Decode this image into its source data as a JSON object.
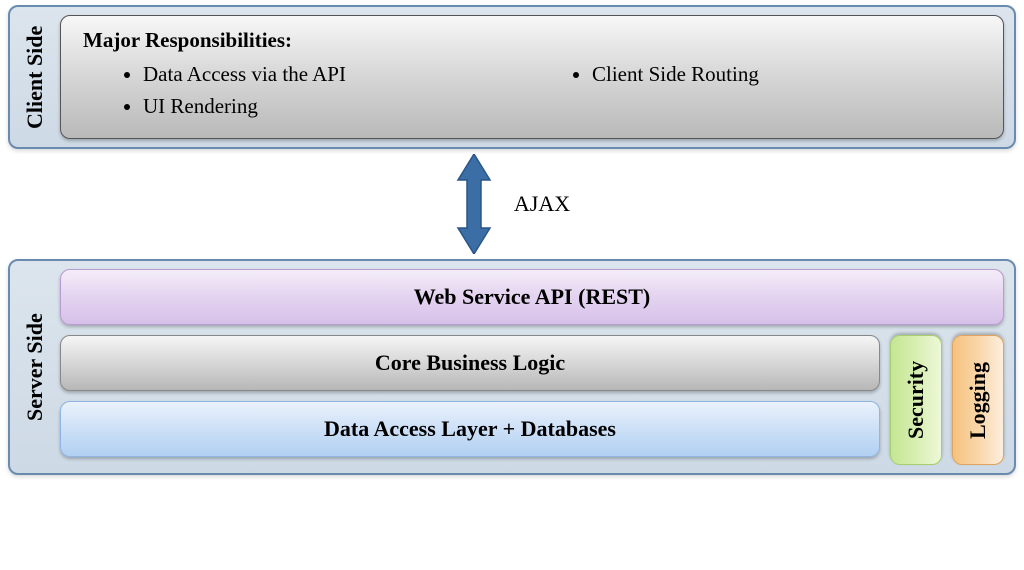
{
  "client": {
    "tier_label": "Client Side",
    "title": "Major Responsibilities:",
    "left_items": [
      "Data Access via the API",
      "UI Rendering"
    ],
    "right_items": [
      "Client Side Routing"
    ]
  },
  "connector": {
    "label": "AJAX",
    "arrow_color": "#3b6ea5"
  },
  "server": {
    "tier_label": "Server Side",
    "layers": {
      "api": "Web Service API (REST)",
      "logic": "Core Business Logic",
      "data": "Data Access Layer + Databases"
    },
    "pillars": {
      "security": "Security",
      "logging": "Logging"
    }
  }
}
